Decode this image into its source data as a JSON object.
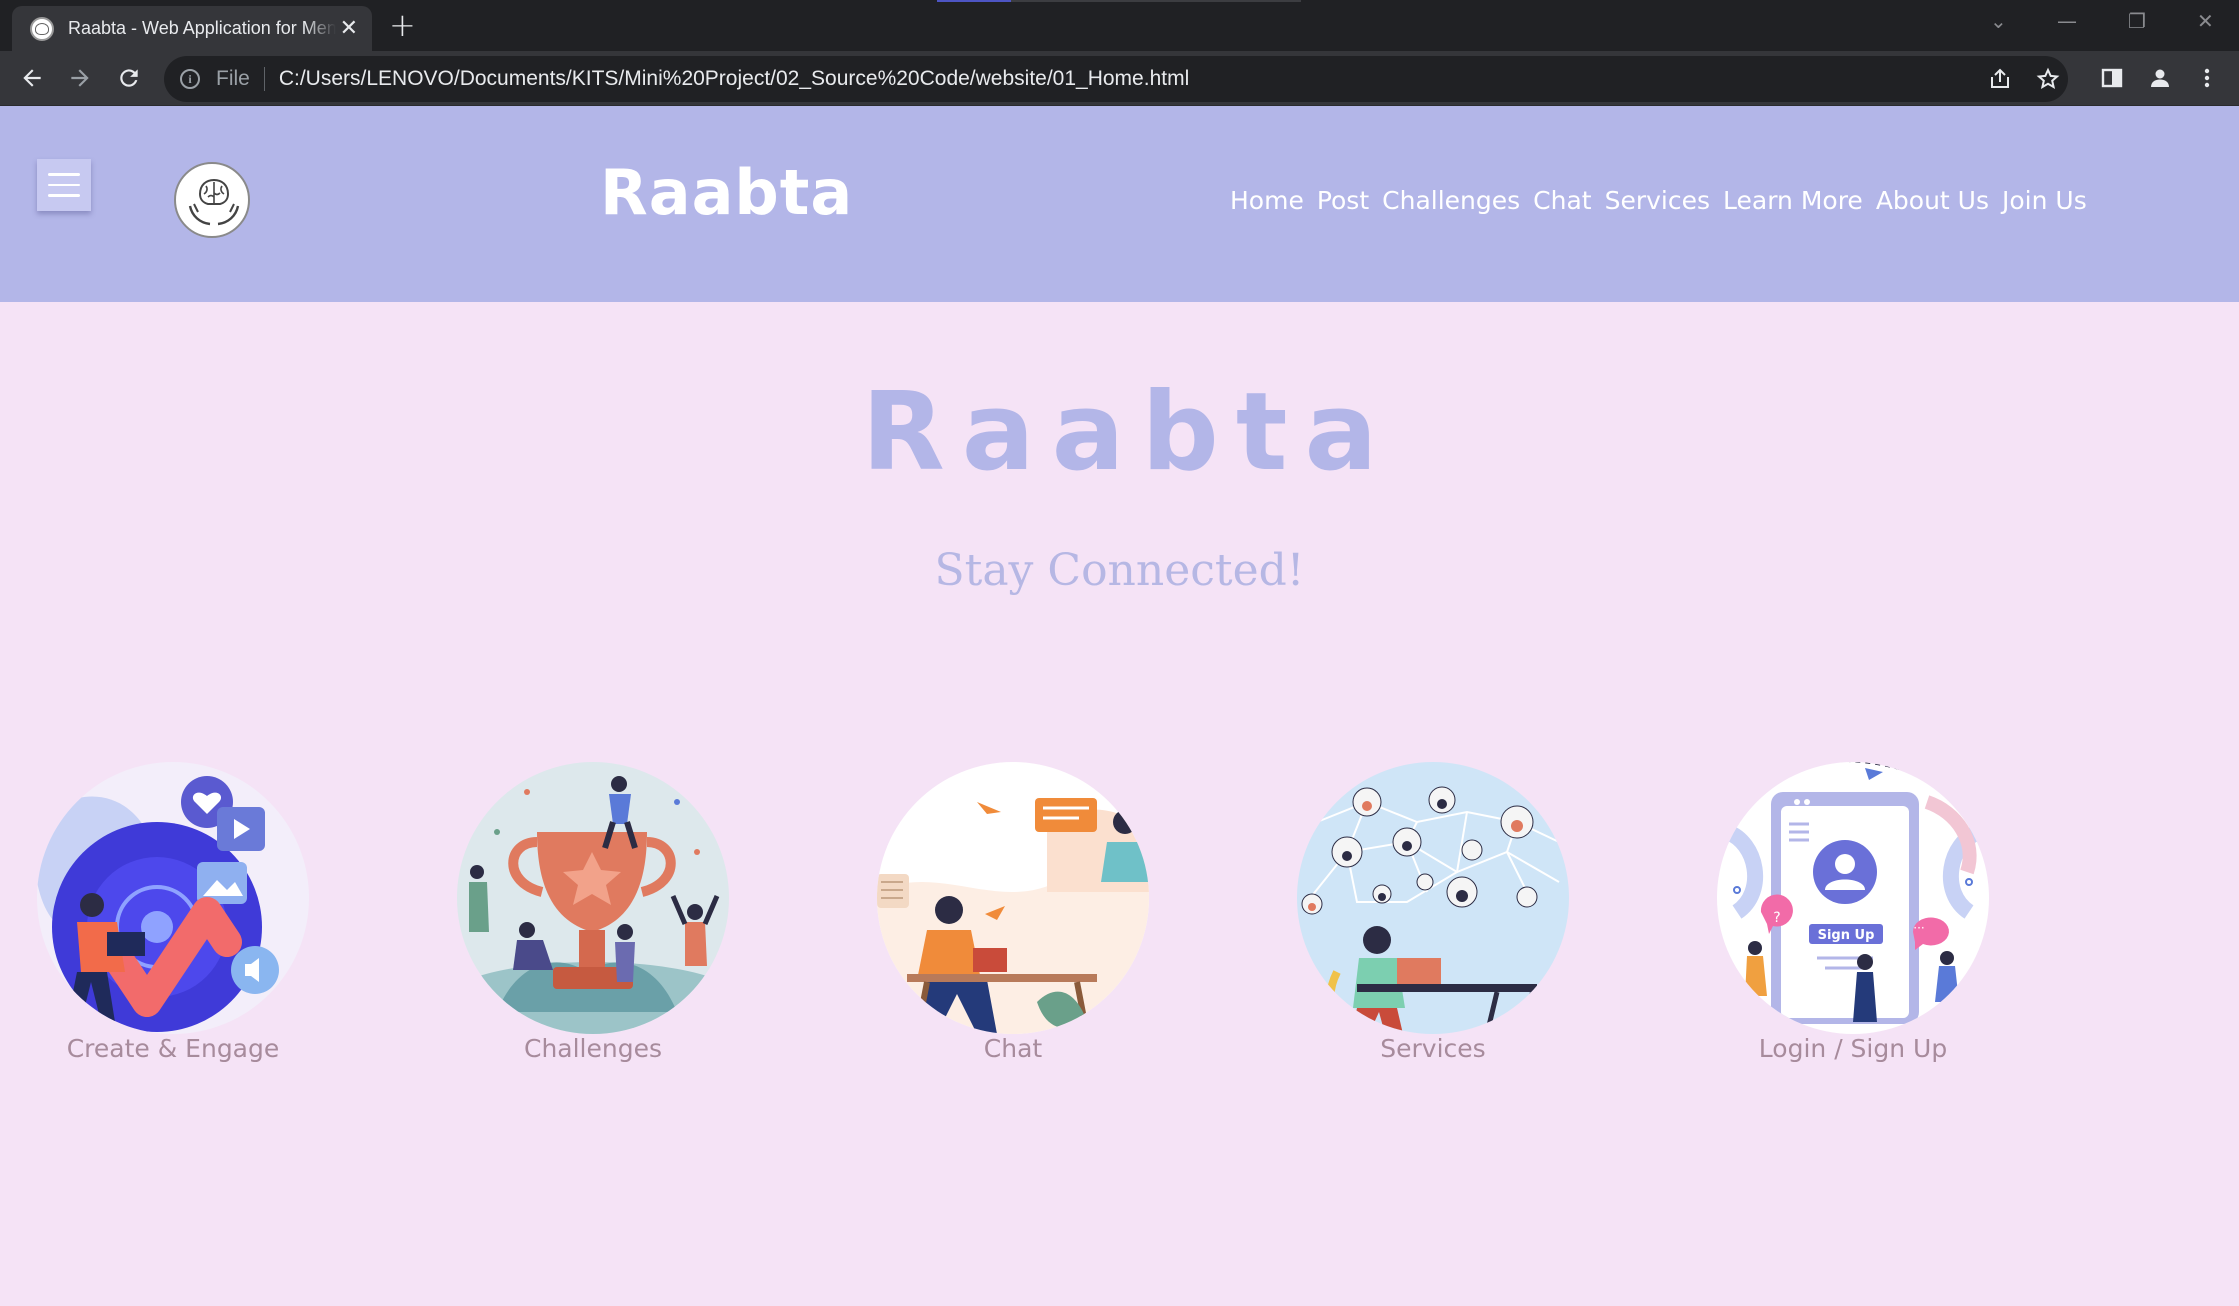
{
  "browser": {
    "tab_title": "Raabta - Web Application for Mental Health",
    "new_tab_label": "+",
    "address": {
      "scheme_label": "File",
      "url": "C:/Users/LENOVO/Documents/KITS/Mini%20Project/02_Source%20Code/website/01_Home.html"
    },
    "icons": [
      "back-arrow-icon",
      "forward-arrow-icon",
      "reload-icon",
      "info-icon",
      "share-icon",
      "star-icon",
      "side-panel-icon",
      "profile-icon",
      "kebab-menu-icon"
    ]
  },
  "header": {
    "brand": "Raabta",
    "nav": [
      "Home",
      "Post",
      "Challenges",
      "Chat",
      "Services",
      "Learn More",
      "About Us",
      "Join Us"
    ]
  },
  "hero": {
    "title": "Raabta",
    "subtitle": "Stay Connected!"
  },
  "features": [
    {
      "label": "Create & Engage"
    },
    {
      "label": "Challenges"
    },
    {
      "label": "Chat"
    },
    {
      "label": "Services"
    },
    {
      "label": "Login / Sign Up",
      "illustration_text": "Sign Up"
    }
  ],
  "colors": {
    "header_bg": "#b3b6e8",
    "page_bg": "#f5e3f6",
    "hero_title": "#b3b6e8",
    "feature_label": "#a78b9c"
  }
}
